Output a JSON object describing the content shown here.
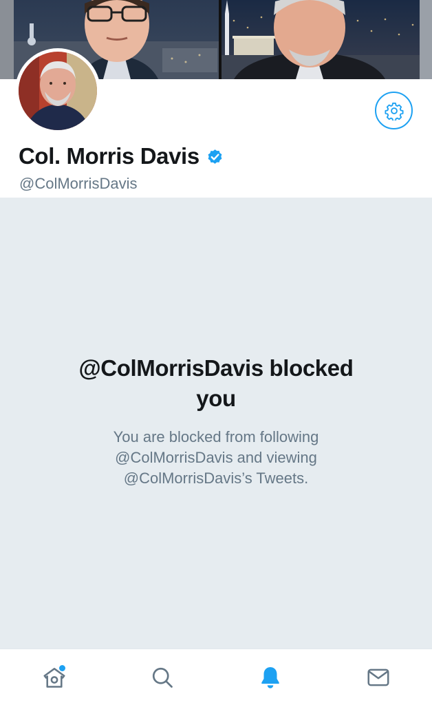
{
  "profile": {
    "name": "Col. Morris Davis",
    "handle": "@ColMorrisDavis",
    "verified": true
  },
  "blocked": {
    "title": "@ColMorrisDavis blocked you",
    "message": "You are blocked from following @ColMorrisDavis and viewing @ColMorrisDavis’s Tweets."
  },
  "tabs": [
    {
      "icon": "home-icon",
      "active": false,
      "has_notification_dot": true
    },
    {
      "icon": "search-icon",
      "active": false
    },
    {
      "icon": "bell-icon",
      "active": true
    },
    {
      "icon": "mail-icon",
      "active": false
    }
  ],
  "colors": {
    "accent": "#1da1f2",
    "panel_background": "#e6ecf0",
    "text_primary": "#14171a",
    "text_secondary": "#657786"
  }
}
